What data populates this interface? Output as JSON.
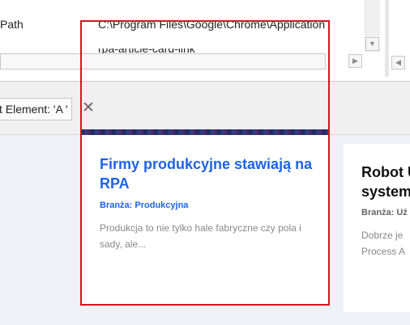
{
  "properties": {
    "row_label": "Path",
    "row_value": "C:\\Program Files\\Google\\Chrome\\Application",
    "row2_value": "rpa-article-card-link"
  },
  "filter": {
    "label": "t Element: 'A '",
    "close_glyph": "✕"
  },
  "scroll": {
    "down_glyph": "▼",
    "right_glyph": "▶",
    "left_glyph": "◀"
  },
  "cards": [
    {
      "title": "Firmy produkcyjne stawiają na RPA",
      "category": "Branża: Produkcyjna",
      "excerpt": "Produkcja to nie tylko hale fabryczne czy pola i sady, ale..."
    },
    {
      "title_line1": "Robot U",
      "title_line2": "system",
      "category": "Branża: Uż",
      "excerpt_line1": "Dobrze je",
      "excerpt_line2": "Process A"
    }
  ],
  "colors": {
    "highlight": "#d9141e",
    "link_blue": "#1f63e6"
  }
}
